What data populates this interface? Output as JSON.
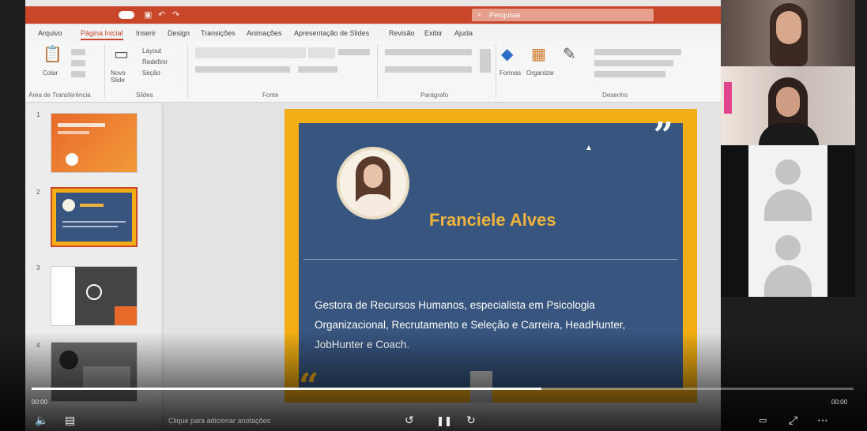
{
  "slide": {
    "name": "Franciele Alves",
    "bio": "Gestora de Recursos Humanos, especialista em Psicologia Organizacional, Recrutamento e Seleção e Carreira, HeadHunter, JobHunter e Coach.",
    "quote_open": "“",
    "quote_close": "”"
  },
  "ribbon": {
    "tabs": [
      "Arquivo",
      "Página Inicial",
      "Inserir",
      "Design",
      "Transições",
      "Animações",
      "Apresentação de Slides",
      "Revisão",
      "Exibir",
      "Ajuda"
    ],
    "active_tab": "Página Inicial",
    "groups": [
      "Área de Transferência",
      "Slides",
      "Fonte",
      "Parágrafo",
      "Desenho"
    ],
    "buttons": {
      "paste": "Colar",
      "new_slide": "Novo Slide",
      "layout": "Layout",
      "reset": "Redefinir",
      "section": "Seção",
      "shapes": "Formas",
      "arrange": "Organizar"
    }
  },
  "slide_numbers": [
    "1",
    "2",
    "3",
    "4"
  ],
  "notes_placeholder": "Clique para adicionar anotações",
  "search_label": "Pesquisar",
  "video": {
    "progress": 0.62,
    "time_elapsed": "00:00",
    "time_total": "00:00"
  },
  "colors": {
    "accent": "#c9462a",
    "slide_border": "#f2ae14",
    "slide_bg": "#37557f",
    "name_color": "#f0b33c"
  }
}
